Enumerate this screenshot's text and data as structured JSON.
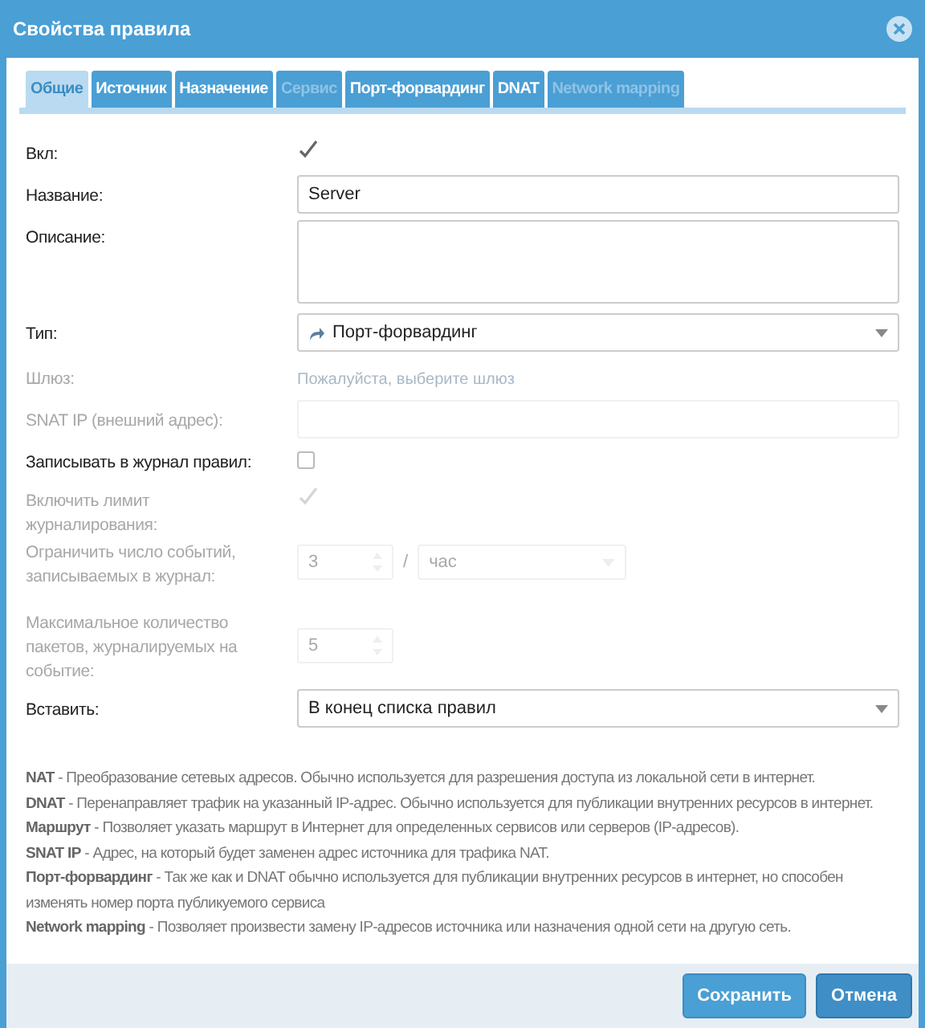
{
  "window": {
    "title": "Свойства правила"
  },
  "tabs": [
    {
      "label": "Общие",
      "selected": true,
      "disabled": false
    },
    {
      "label": "Источник",
      "selected": false,
      "disabled": false
    },
    {
      "label": "Назначение",
      "selected": false,
      "disabled": false
    },
    {
      "label": "Сервис",
      "selected": false,
      "disabled": true
    },
    {
      "label": "Порт-форвардинг",
      "selected": false,
      "disabled": false
    },
    {
      "label": "DNAT",
      "selected": false,
      "disabled": false
    },
    {
      "label": "Network mapping",
      "selected": false,
      "disabled": true
    }
  ],
  "fields": [
    {
      "kind": "checkbox",
      "label": "Вкл:",
      "checked": true,
      "disabled": false
    },
    {
      "kind": "text",
      "label": "Название:",
      "value": "Server",
      "disabled": false
    },
    {
      "kind": "textarea",
      "label": "Описание:",
      "disabled": false
    },
    {
      "kind": "type_select",
      "label": "Тип:",
      "value": "Порт-форвардинг",
      "disabled": false
    },
    {
      "kind": "hint",
      "label": "Шлюз:",
      "placeholder": "Пожалуйста, выберите шлюз",
      "disabled": true
    },
    {
      "kind": "text",
      "label": "SNAT IP (внешний адрес):",
      "disabled": true
    },
    {
      "kind": "checkbox",
      "label": "Записывать в журнал правил:",
      "checked": false,
      "disabled": false
    },
    {
      "kind": "checkbox",
      "label": "Включить лимит журналирования:",
      "checked": true,
      "disabled": true
    },
    {
      "kind": "number_pair",
      "label": "Ограничить число событий, записываемых в журнал:",
      "value": "3",
      "separator": "/",
      "unit": "час",
      "disabled": true
    },
    {
      "kind": "number",
      "label": "Максимальное количество пакетов, журналируемых на событие:",
      "value": "5",
      "disabled": true
    },
    {
      "kind": "select",
      "label": "Вставить:",
      "value": "В конец списка правил",
      "disabled": false
    }
  ],
  "help": [
    "**NAT** - Преобразование сетевых адресов. Обычно используется для разрешения доступа из локальной сети в интернет.",
    "**DNAT** - Перенаправляет трафик на указанный IP-адрес. Обычно используется для публикации внутренних ресурсов в интернет.",
    "**Маршрут** - Позволяет указать маршрут в Интернет для определенных сервисов или серверов (IP-адресов).",
    "**SNAT IP** - Адрес, на который будет заменен адрес источника для трафика NAT.",
    "**Порт-форвардинг** - Так же как и DNAT обычно используется для публикации внутренних ресурсов в интернет, но способен изменять номер порта публикуемого сервиса",
    "**Network mapping** - Позволяет произвести замену IP-адресов источника или назначения одной сети на другую сеть."
  ],
  "buttons": [
    {
      "label": "Сохранить",
      "kind": "primary"
    },
    {
      "label": "Отмена",
      "kind": "secondary"
    }
  ]
}
